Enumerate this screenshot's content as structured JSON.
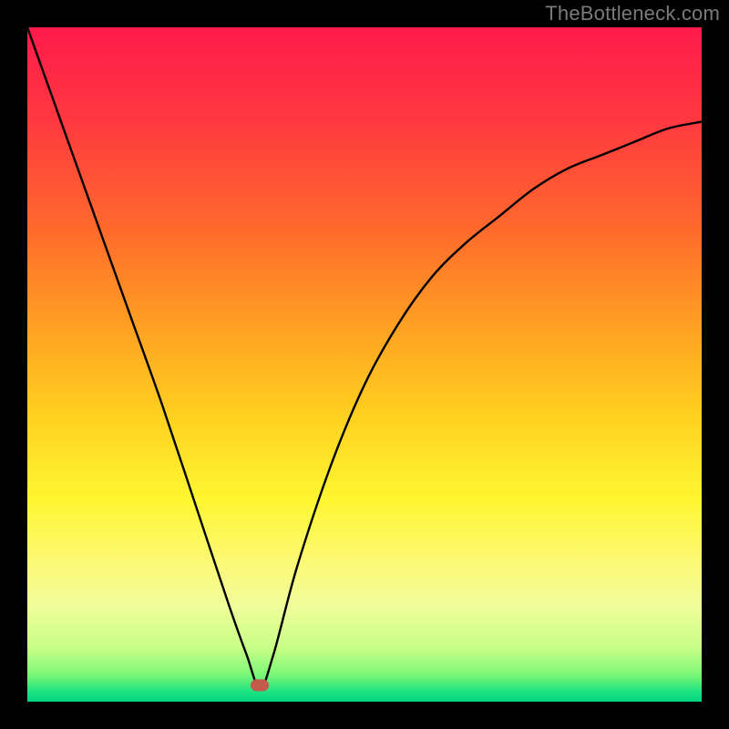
{
  "watermark": "TheBottleneck.com",
  "marker": {
    "x_frac": 0.345,
    "y_frac": 0.975
  },
  "chart_data": {
    "type": "line",
    "title": "",
    "xlabel": "",
    "ylabel": "",
    "xlim": [
      0,
      1
    ],
    "ylim": [
      0,
      1
    ],
    "series": [
      {
        "name": "bottleneck-curve",
        "x": [
          0.0,
          0.05,
          0.1,
          0.15,
          0.2,
          0.25,
          0.3,
          0.325,
          0.345,
          0.365,
          0.4,
          0.45,
          0.5,
          0.55,
          0.6,
          0.65,
          0.7,
          0.75,
          0.8,
          0.85,
          0.9,
          0.95,
          1.0
        ],
        "y": [
          1.0,
          0.86,
          0.72,
          0.58,
          0.44,
          0.29,
          0.14,
          0.07,
          0.02,
          0.07,
          0.2,
          0.35,
          0.47,
          0.56,
          0.63,
          0.68,
          0.72,
          0.76,
          0.79,
          0.81,
          0.83,
          0.85,
          0.86
        ]
      }
    ],
    "annotations": [
      {
        "name": "optimum-point",
        "x": 0.345,
        "y": 0.025
      }
    ],
    "background_gradient": {
      "orientation": "vertical",
      "stops": [
        {
          "pos": 0.0,
          "color": "#ff1a4b"
        },
        {
          "pos": 0.45,
          "color": "#ffa322"
        },
        {
          "pos": 0.7,
          "color": "#fff630"
        },
        {
          "pos": 1.0,
          "color": "#00d57c"
        }
      ]
    }
  }
}
